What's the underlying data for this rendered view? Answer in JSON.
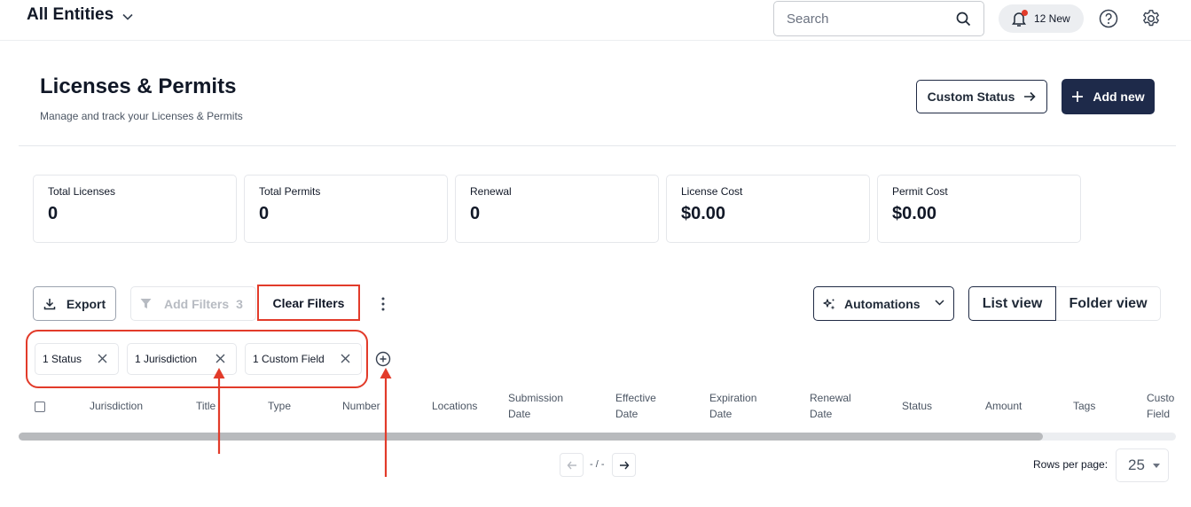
{
  "topbar": {
    "entity_label": "All Entities",
    "search_placeholder": "Search",
    "notifications_label": "12 New"
  },
  "header": {
    "title": "Licenses & Permits",
    "subtitle": "Manage and track your Licenses & Permits",
    "custom_status_label": "Custom Status",
    "add_new_label": "Add new"
  },
  "stats": [
    {
      "label": "Total Licenses",
      "value": "0"
    },
    {
      "label": "Total Permits",
      "value": "0"
    },
    {
      "label": "Renewal",
      "value": "0"
    },
    {
      "label": "License Cost",
      "value": "$0.00"
    },
    {
      "label": "Permit Cost",
      "value": "$0.00"
    }
  ],
  "toolbar": {
    "export_label": "Export",
    "add_filters_label": "Add Filters",
    "add_filters_count": "3",
    "clear_filters_label": "Clear Filters",
    "automations_label": "Automations",
    "list_view_label": "List view",
    "folder_view_label": "Folder view"
  },
  "filter_chips": [
    "1 Status",
    "1 Jurisdiction",
    "1 Custom Field"
  ],
  "table": {
    "columns": [
      [
        "Jurisdiction"
      ],
      [
        "Title"
      ],
      [
        "Type"
      ],
      [
        "Number"
      ],
      [
        "Locations"
      ],
      [
        "Submission",
        "Date"
      ],
      [
        "Effective",
        "Date"
      ],
      [
        "Expiration",
        "Date"
      ],
      [
        "Renewal",
        "Date"
      ],
      [
        "Status"
      ],
      [
        "Amount"
      ],
      [
        "Tags"
      ],
      [
        "Custo",
        "Field"
      ]
    ]
  },
  "pagination": {
    "page_text": "- / -",
    "rows_per_page_label": "Rows per page:",
    "rows_per_page_value": "25"
  },
  "colors": {
    "accent_navy": "#1e2a4a",
    "annotation_red": "#e23b2a"
  }
}
